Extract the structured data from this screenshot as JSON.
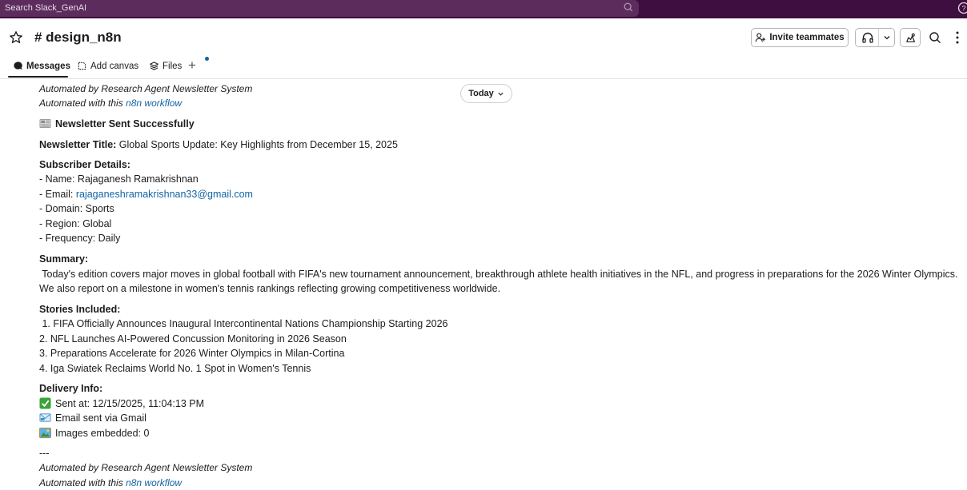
{
  "search": {
    "placeholder": "Search Slack_GenAI"
  },
  "channel": {
    "name": "# design_n8n"
  },
  "header": {
    "invite_label": "Invite teammates"
  },
  "tabs": [
    {
      "label": "Messages"
    },
    {
      "label": "Add canvas"
    },
    {
      "label": "Files"
    }
  ],
  "date_divider": "Today",
  "message": {
    "top_footer_line1": "Automated by Research Agent Newsletter System",
    "top_footer_line2_prefix": "Automated with this ",
    "top_footer_link": "n8n workflow",
    "heading": "Newsletter Sent Successfully",
    "title_label": "Newsletter Title:",
    "title_value": " Global Sports Update: Key Highlights from December 15, 2025",
    "subscriber_heading": "Subscriber Details:",
    "name": "- Name: Rajaganesh Ramakrishnan",
    "email_prefix": "- Email: ",
    "email": "rajaganeshramakrishnan33@gmail.com",
    "domain": "- Domain: Sports",
    "region": "- Region: Global",
    "frequency": "- Frequency: Daily",
    "summary_heading": "Summary:",
    "summary_line1": " Today's edition covers major moves in global football with FIFA's new tournament announcement, breakthrough athlete health initiatives in the NFL, and progress in preparations for the 2026 Winter Olympics.",
    "summary_line2": "We also report on a milestone in women's tennis rankings reflecting growing competitiveness worldwide.",
    "stories_heading": "Stories Included:",
    "stories": [
      " 1. FIFA Officially Announces Inaugural Intercontinental Nations Championship Starting 2026",
      "2. NFL Launches AI-Powered Concussion Monitoring in 2026 Season",
      "3. Preparations Accelerate for 2026 Winter Olympics in Milan-Cortina",
      "4. Iga Swiatek Reclaims World No. 1 Spot in Women's Tennis"
    ],
    "delivery_heading": "Delivery Info:",
    "sent_at": "Sent at: 12/15/2025, 11:04:13 PM",
    "email_via": "Email sent via Gmail",
    "images": "Images embedded: 0",
    "separator": "---",
    "bottom_footer_line1": "Automated by Research Agent Newsletter System",
    "bottom_footer_line2_prefix": "Automated with this ",
    "bottom_footer_link": "n8n workflow"
  },
  "colors": {
    "topbar": "#3f0e40",
    "link": "#1264a3",
    "accent_dot": "#1264a3"
  },
  "icons": [
    "search-icon",
    "help-icon",
    "star-icon",
    "invite-person-icon",
    "headphones-icon",
    "chevron-down-icon",
    "canvas-icon",
    "search-icon",
    "kebab-icon",
    "newspaper-icon",
    "check-icon",
    "email-icon",
    "image-icon"
  ]
}
